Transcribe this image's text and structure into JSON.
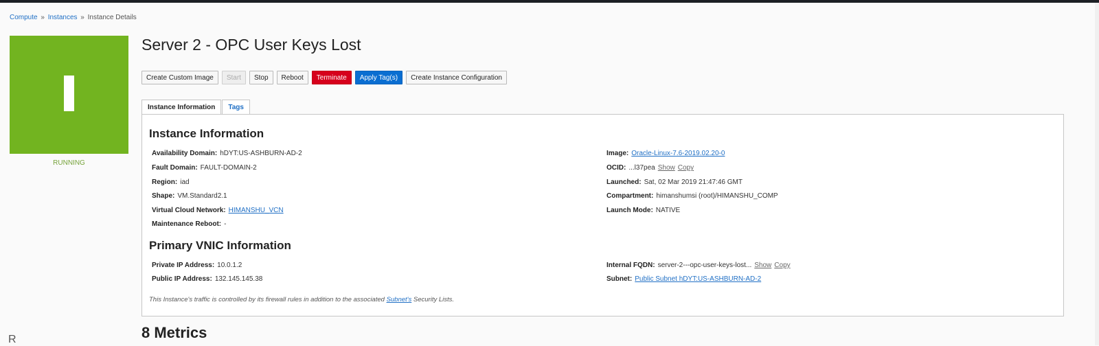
{
  "breadcrumb": {
    "items": [
      "Compute",
      "Instances",
      "Instance Details"
    ],
    "separator": "»"
  },
  "status": {
    "label": "RUNNING",
    "tile_color": "#72b420",
    "glyph": "I"
  },
  "title": "Server 2 - OPC User Keys Lost",
  "actions": {
    "create_custom_image": "Create Custom Image",
    "start": "Start",
    "stop": "Stop",
    "reboot": "Reboot",
    "terminate": "Terminate",
    "apply_tags": "Apply Tag(s)",
    "create_instance_configuration": "Create Instance Configuration"
  },
  "tabs": {
    "instance_information": "Instance Information",
    "tags": "Tags"
  },
  "instance_info": {
    "heading": "Instance Information",
    "availability_domain": {
      "label": "Availability Domain:",
      "value": "hDYT:US-ASHBURN-AD-2"
    },
    "fault_domain": {
      "label": "Fault Domain:",
      "value": "FAULT-DOMAIN-2"
    },
    "region": {
      "label": "Region:",
      "value": "iad"
    },
    "shape": {
      "label": "Shape:",
      "value": "VM.Standard2.1"
    },
    "vcn": {
      "label": "Virtual Cloud Network:",
      "value": "HIMANSHU_VCN"
    },
    "maintenance_reboot": {
      "label": "Maintenance Reboot:",
      "value": "-"
    },
    "image": {
      "label": "Image:",
      "value": "Oracle-Linux-7.6-2019.02.20-0"
    },
    "ocid": {
      "label": "OCID:",
      "value": "...l37pea",
      "show": "Show",
      "copy": "Copy"
    },
    "launched": {
      "label": "Launched:",
      "value": "Sat, 02 Mar 2019 21:47:46 GMT"
    },
    "compartment": {
      "label": "Compartment:",
      "value": "himanshumsi (root)/HIMANSHU_COMP"
    },
    "launch_mode": {
      "label": "Launch Mode:",
      "value": "NATIVE"
    }
  },
  "vnic_info": {
    "heading": "Primary VNIC Information",
    "private_ip": {
      "label": "Private IP Address:",
      "value": "10.0.1.2"
    },
    "public_ip": {
      "label": "Public IP Address:",
      "value": "132.145.145.38"
    },
    "internal_fqdn": {
      "label": "Internal FQDN:",
      "value": "server-2---opc-user-keys-lost...",
      "show": "Show",
      "copy": "Copy"
    },
    "subnet": {
      "label": "Subnet:",
      "value": "Public Subnet hDYT:US-ASHBURN-AD-2"
    }
  },
  "footnote": {
    "before": "This Instance's traffic is controlled by its firewall rules in addition to the associated ",
    "link": "Subnet's",
    "after": " Security Lists."
  },
  "metrics_title": "8 Metrics",
  "cut_left_text": "R"
}
